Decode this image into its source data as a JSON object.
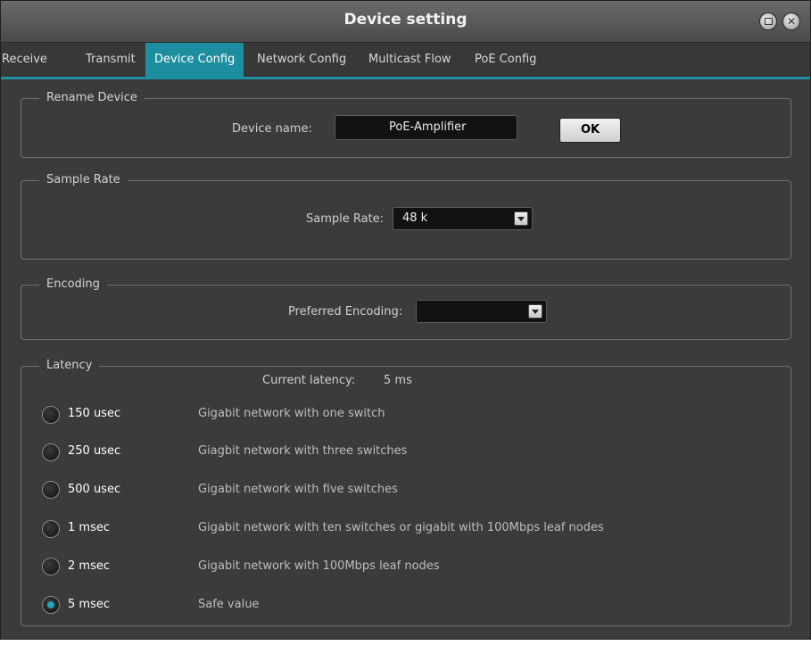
{
  "window": {
    "title": "Device setting"
  },
  "tabs": [
    {
      "label": "Receive",
      "active": false
    },
    {
      "label": "Transmit",
      "active": false
    },
    {
      "label": "Device Config",
      "active": true
    },
    {
      "label": "Network Config",
      "active": false
    },
    {
      "label": "Multicast Flow",
      "active": false
    },
    {
      "label": "PoE Config",
      "active": false
    }
  ],
  "rename": {
    "legend": "Rename Device",
    "label": "Device name:",
    "value": "PoE-Amplifier",
    "ok_label": "OK"
  },
  "sample_rate": {
    "legend": "Sample Rate",
    "label": "Sample Rate:",
    "value": "48 k"
  },
  "encoding": {
    "legend": "Encoding",
    "label": "Preferred Encoding:",
    "value": ""
  },
  "latency": {
    "legend": "Latency",
    "current_label": "Current latency:",
    "current_value": "5 ms",
    "options": [
      {
        "label": "150 usec",
        "desc": "Gigabit network with one switch",
        "checked": false
      },
      {
        "label": "250 usec",
        "desc": "Giagbit network with three switches",
        "checked": false
      },
      {
        "label": "500 usec",
        "desc": "Gigabit network with five switches",
        "checked": false
      },
      {
        "label": "1 msec",
        "desc": "Gigabit network with ten switches or gigabit with 100Mbps leaf nodes",
        "checked": false
      },
      {
        "label": "2 msec",
        "desc": "Gigabit network with 100Mbps leaf nodes",
        "checked": false
      },
      {
        "label": "5 msec",
        "desc": "Safe value",
        "checked": true
      }
    ]
  },
  "colors": {
    "accent": "#1d8ea0",
    "background": "#3b3b3b"
  }
}
